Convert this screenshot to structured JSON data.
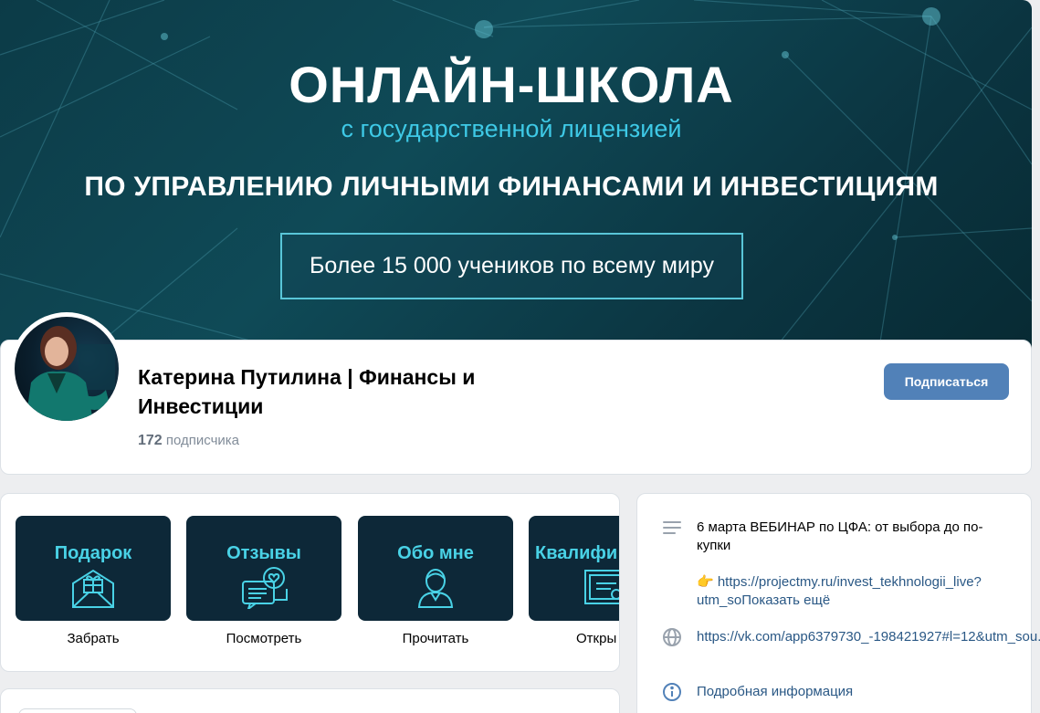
{
  "cover": {
    "title": "ОНЛАЙН-ШКОЛА",
    "subtitle": "с государственной лицензией",
    "line": "ПО УПРАВЛЕНИЮ  ЛИЧНЫМИ ФИНАНСАМИ И ИНВЕСТИЦИЯМ",
    "box_text": "Более 15 000 учеников по всему миру"
  },
  "profile": {
    "name": "Катерина Путилина | Финансы и Инвестиции",
    "followers_count": "172",
    "followers_label": " подписчика",
    "subscribe_label": "Подписаться"
  },
  "links": [
    {
      "title": "Подарок",
      "icon": "gift-envelope-icon",
      "caption": "Забрать"
    },
    {
      "title": "Отзывы",
      "icon": "chat-heart-icon",
      "caption": "Посмотреть"
    },
    {
      "title": "Обо мне",
      "icon": "person-icon",
      "caption": "Прочитать"
    },
    {
      "title": "Квалифи",
      "icon": "certificate-icon",
      "caption": "Откры"
    }
  ],
  "info": {
    "description": "6 марта ВЕБИНАР по ЦФА: от выбора до по-купки",
    "link_prefix": "👉 https://projectmy.ru/invest_tekhnologii_live?utm_so",
    "show_more": "Показать ещё",
    "site": "https://vk.com/app6379730_-198421927#l=12&utm_sou..",
    "details": "Подробная информация"
  },
  "colors": {
    "accent": "#5181b8",
    "link": "#2a5885",
    "tile_bg": "#0d2838",
    "tile_text": "#49d2e6",
    "cover_sub": "#3ec9e6"
  }
}
